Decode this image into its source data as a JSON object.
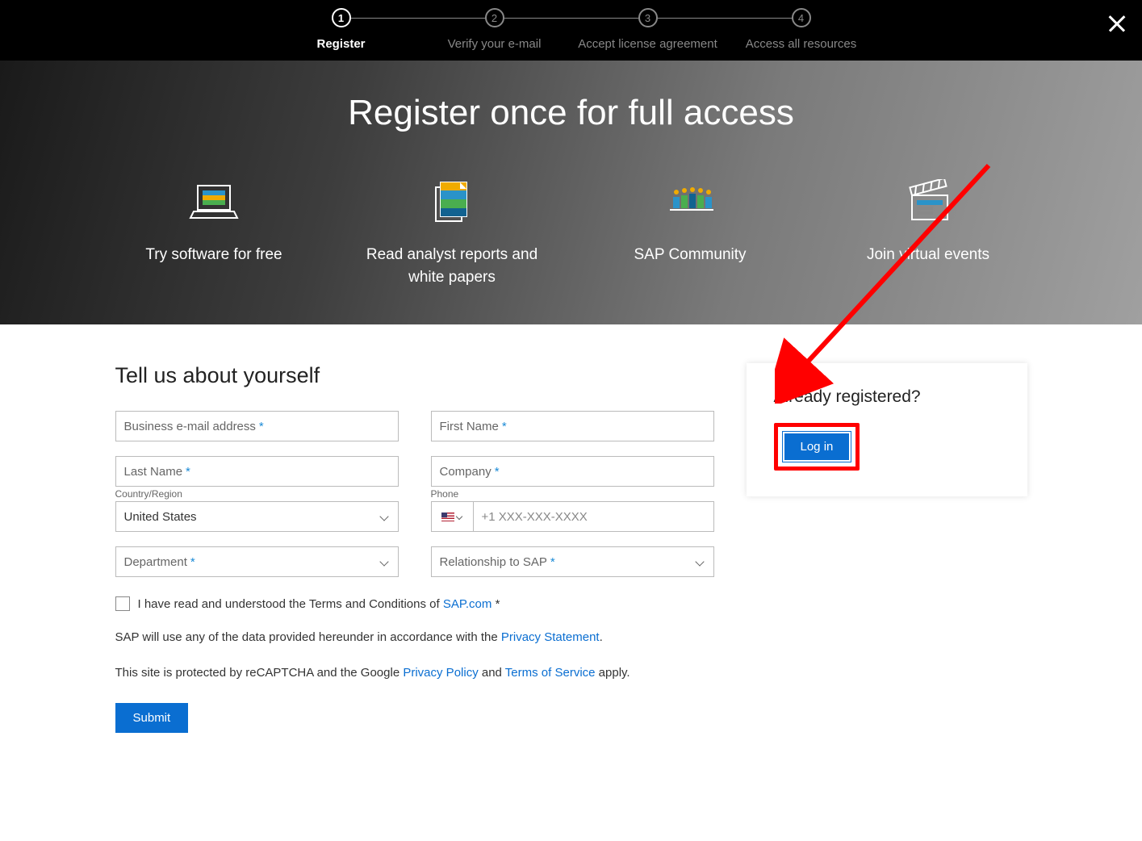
{
  "stepper": {
    "steps": [
      {
        "num": "1",
        "label": "Register",
        "active": true
      },
      {
        "num": "2",
        "label": "Verify your e-mail",
        "active": false
      },
      {
        "num": "3",
        "label": "Accept license agreement",
        "active": false
      },
      {
        "num": "4",
        "label": "Access all resources",
        "active": false
      }
    ]
  },
  "hero": {
    "title": "Register once for full access",
    "benefits": [
      "Try software for free",
      "Read analyst reports and white papers",
      "SAP Community",
      "Join virtual events"
    ]
  },
  "form": {
    "heading": "Tell us about yourself",
    "email_label": "Business e-mail address",
    "first_name_label": "First Name",
    "last_name_label": "Last Name",
    "company_label": "Company",
    "country_label": "Country/Region",
    "country_value": "United States",
    "phone_label": "Phone",
    "phone_placeholder": "+1 XXX-XXX-XXXX",
    "department_label": "Department",
    "relationship_label": "Relationship to SAP",
    "terms_prefix": "I have read and understood the Terms and Conditions of ",
    "terms_link": "SAP.com",
    "privacy_prefix": "SAP will use any of the data provided hereunder in accordance with the ",
    "privacy_link": "Privacy Statement",
    "recaptcha_prefix": "This site is protected by reCAPTCHA and the Google ",
    "recaptcha_pp": "Privacy Policy",
    "recaptcha_and": " and ",
    "recaptcha_tos": "Terms of Service",
    "recaptcha_suffix": " apply.",
    "submit": "Submit"
  },
  "side": {
    "heading": "Already registered?",
    "login": "Log in"
  }
}
